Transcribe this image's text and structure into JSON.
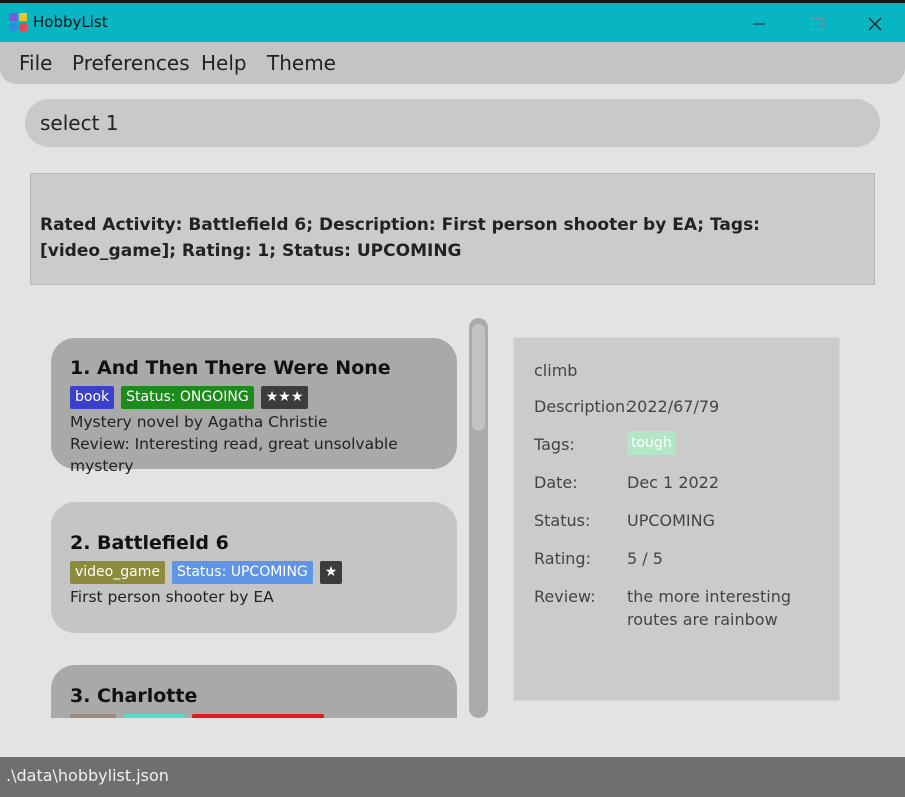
{
  "window": {
    "title": "HobbyList",
    "close_glyph": "✕"
  },
  "menu": [
    "File",
    "Preferences",
    "Help",
    "Theme"
  ],
  "command": {
    "value": "select 1"
  },
  "result": {
    "text": "Rated Activity: Battlefield 6; Description: First person shooter by EA; Tags: [video_game]; Rating: 1; Status: UPCOMING"
  },
  "activities": [
    {
      "title": "1.  And Then There Were None",
      "tags": [
        {
          "label": "book",
          "color": "#3b3fc9"
        },
        {
          "label": "Status: ONGOING",
          "color": "#1d8a1d"
        },
        {
          "label": "★★★",
          "color": "#3c3c3c"
        }
      ],
      "lines": [
        "Mystery novel by Agatha Christie",
        "Review: Interesting read, great unsolvable mystery"
      ],
      "selected": true
    },
    {
      "title": "2.  Battlefield 6",
      "tags": [
        {
          "label": "video_game",
          "color": "#8c8c3c"
        },
        {
          "label": "Status: UPCOMING",
          "color": "#5f95e6"
        },
        {
          "label": "★",
          "color": "#3c3c3c"
        }
      ],
      "lines": [
        "First person shooter by EA"
      ],
      "selected": false
    },
    {
      "title": "3.  Charlotte",
      "tags": [
        {
          "label": "",
          "color": "#9b8a80"
        },
        {
          "label": "",
          "color": "#58dcc8"
        },
        {
          "label": "",
          "color": "#e41a1a"
        }
      ],
      "lines": [],
      "selected": false
    }
  ],
  "detail": {
    "name": "climb",
    "description_label": "Description:",
    "description": "2022/67/79",
    "tags_label": "Tags:",
    "tag": "tough",
    "tag_color": "#b3e6c6",
    "date_label": "Date:",
    "date": "Dec 1 2022",
    "status_label": "Status:",
    "status": "UPCOMING",
    "rating_label": "Rating:",
    "rating": "5 / 5",
    "review_label": "Review:",
    "review": "the more interesting routes are rainbow"
  },
  "statusbar": {
    "path": ".\\data\\hobbylist.json"
  }
}
